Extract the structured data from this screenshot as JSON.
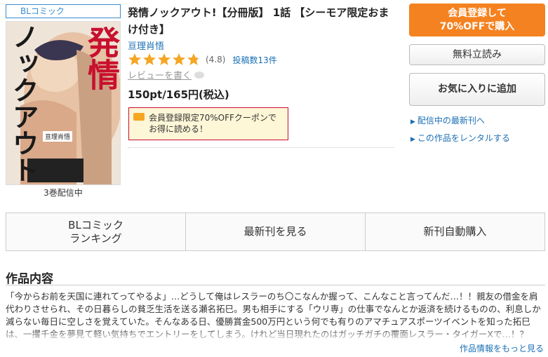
{
  "category": "BLコミック",
  "cover": {
    "title_line1": "ノックアウト",
    "title_line2": "発情",
    "author_small": "亘理肖悟",
    "volumes_text": "3巻配信中"
  },
  "product": {
    "title": "発情ノックアウト!【分冊版】 1話 【シーモア限定おまけ付き】",
    "author": "亘理肖悟",
    "rating": 4.8,
    "rating_text": "(4.8)",
    "review_count_text": "投稿数13件",
    "write_review": "レビューを書く",
    "price": "150pt/165円(税込)",
    "coupon_text": "会員登録限定70%OFFクーポンでお得に読める！"
  },
  "actions": {
    "register_line1": "会員登録して",
    "register_line2": "70%OFFで購入",
    "free_read": "無料立読み",
    "favorite": "お気に入りに追加",
    "link_latest": "配信中の最新刊へ",
    "link_rental": "この作品をレンタルする"
  },
  "tabs": [
    {
      "label": "BLコミック\nランキング"
    },
    {
      "label": "最新刊を見る"
    },
    {
      "label": "新刊自動購入"
    }
  ],
  "section": {
    "title": "作品内容",
    "synopsis": "「今からお前を天国に連れてってやるよ」…どうして俺はレスラーのち〇こなんか握って、こんなこと言ってんだ…！！親友の借金を肩代わりさせられ、その日暮らしの貧乏生活を送る瀬名拓巳。男も相手にする「ウリ専」の仕事でなんとか返済を続けるものの、利息しか減らない毎日に空しさを覚えていた。そんなある日、優勝賞金500万円という何でも有りのアマチュアスポーツイベントを知った拓巳は、一攫千金を夢見て軽い気持ちでエントリーをしてしまう。けれど当日現れたのはガッチガチの覆面レスラー・タイガーXで…！？「このままじゃ確実に負け",
    "more_link": "作品情報をもっと見る"
  },
  "colors": {
    "accent": "#f58220",
    "link": "#1a6fb4",
    "star": "#f5a623",
    "coupon_border": "#c8102e"
  }
}
